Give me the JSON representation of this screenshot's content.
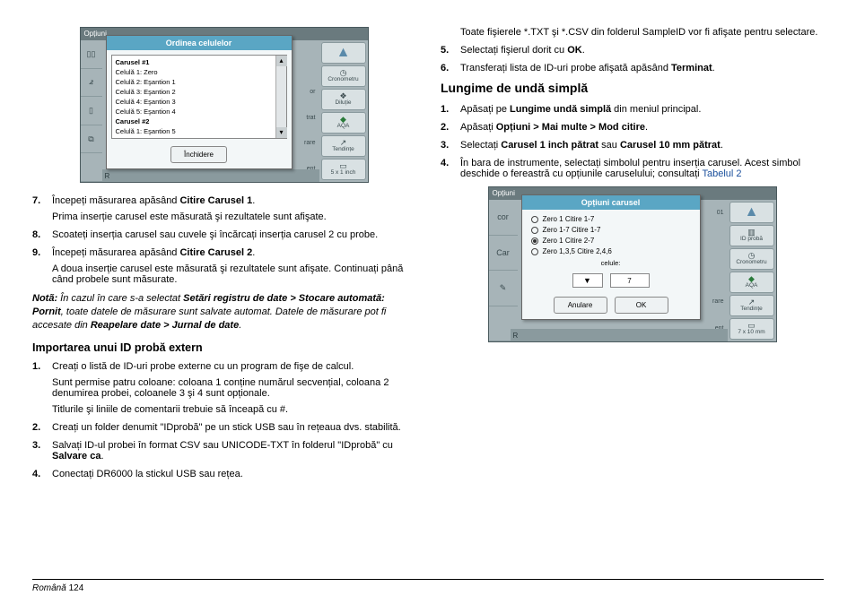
{
  "figure1": {
    "topbar": "Opțiuni",
    "modal_title": "Ordinea celulelor",
    "list": [
      {
        "text": "Carusel #1",
        "bold": true
      },
      {
        "text": "Celulă 1: Zero",
        "bold": false
      },
      {
        "text": "Celulă 2: Eşantion 1",
        "bold": false
      },
      {
        "text": "Celulă 3: Eşantion 2",
        "bold": false
      },
      {
        "text": "Celulă 4: Eşantion 3",
        "bold": false
      },
      {
        "text": "Celulă 5: Eşantion 4",
        "bold": false
      },
      {
        "text": "Carusel #2",
        "bold": true
      },
      {
        "text": "Celulă 1: Eşantion 5",
        "bold": false
      }
    ],
    "close": "Închidere",
    "rightbtns": [
      "",
      "Cronometru",
      "Diluție",
      "AQA",
      "Tendințe",
      "5 x 1 inch"
    ],
    "after_right": [
      "",
      "",
      "or",
      "trat",
      "rare",
      "ent"
    ],
    "bottom_r": "R"
  },
  "left": {
    "steps_a": [
      {
        "n": "7.",
        "text": "Începeți măsurarea apăsând <b>Citire Carusel 1</b>.",
        "p": "Prima inserție carusel este măsurată şi rezultatele sunt afişate."
      },
      {
        "n": "8.",
        "text": "Scoateți inserția carusel sau cuvele şi încărcați inserția carusel 2 cu probe."
      },
      {
        "n": "9.",
        "text": "Începeți măsurarea apăsând <b>Citire Carusel 2</b>.",
        "p": "A doua inserție carusel este măsurată şi rezultatele sunt afişate. Continuați până când probele sunt măsurate."
      }
    ],
    "note": "<b><i>Notã:</i></b> <i>În cazul în care s-a selectat <b>Setări registru de date > Stocare automată: Pornit</b>, toate datele de măsurare sunt salvate automat. Datele de măsurare pot fi accesate din <b>Reapelare date > Jurnal de date</b>.</i>",
    "heading2": "Importarea unui ID probă extern",
    "steps_b": [
      {
        "n": "1.",
        "text": "Creați o listă de ID-uri probe externe cu un program de fişe de calcul.",
        "p1": "Sunt permise patru coloane: coloana 1 conține numărul secvențial, coloana 2  denumirea probei, coloanele 3 şi 4 sunt opționale.",
        "p2": "Titlurile şi liniile de comentarii trebuie să înceapă cu #."
      },
      {
        "n": "2.",
        "text": "Creați un folder denumit \"IDprobă\" pe un stick USB sau în rețeaua dvs. stabilită."
      },
      {
        "n": "3.",
        "text": "Salvați ID-ul probei în format CSV sau UNICODE-TXT în folderul \"IDprobă\" cu <b>Salvare ca</b>."
      },
      {
        "n": "4.",
        "text": "Conectați DR6000 la stickul USB sau rețea."
      }
    ]
  },
  "right": {
    "top_para": "Toate fişierele *.TXT şi *.CSV din folderul SampleID vor fi afişate pentru selectare.",
    "steps_c": [
      {
        "n": "5.",
        "text": "Selectați fişierul dorit cu <b>OK</b>."
      },
      {
        "n": "6.",
        "text": "Transferați lista de ID-uri probe afişată apăsând <b>Terminat</b>."
      }
    ],
    "heading": "Lungime de undă simplă",
    "steps_d": [
      {
        "n": "1.",
        "text": "Apăsați pe <b>Lungime undă simplă</b> din meniul principal."
      },
      {
        "n": "2.",
        "text": "Apăsați <b>Opțiuni > Mai multe > Mod citire</b>."
      },
      {
        "n": "3.",
        "text": "Selectați <b>Carusel 1 inch pătrat</b> sau <b>Carusel 10 mm pătrat</b>."
      },
      {
        "n": "4.",
        "text": "În bara de instrumente, selectați simbolul pentru inserția carusel. Acest simbol deschide o fereastră cu opțiunile caruselului; consultați ",
        "link": "Tabelul 2"
      }
    ]
  },
  "figure2": {
    "topbar": "Opțiuni",
    "modal_title": "Opțiuni carusel",
    "left_col": [
      "cor",
      "Car",
      "✎",
      ""
    ],
    "after_right": [
      "01",
      "",
      ""
    ],
    "opts": [
      {
        "label": "Zero 1  Citire 1-7",
        "sel": false
      },
      {
        "label": "Zero 1-7  Citire 1-7",
        "sel": false
      },
      {
        "label": "Zero 1  Citire 2-7",
        "sel": true
      },
      {
        "label": "Zero 1,3,5  Citire 2,4,6",
        "sel": false
      }
    ],
    "celule": "celule:",
    "cel_btn": "▼",
    "cel_val": "7",
    "cancel": "Anulare",
    "ok": "OK",
    "rightbtns": [
      "",
      "ID probă",
      "Cronometru",
      "AQA",
      "Tendințe",
      "7 x 10 mm"
    ],
    "after_bottom": [
      "rare",
      "ent"
    ],
    "bottom_r": "R"
  },
  "footer": {
    "lang": "Română",
    "page": "124"
  }
}
